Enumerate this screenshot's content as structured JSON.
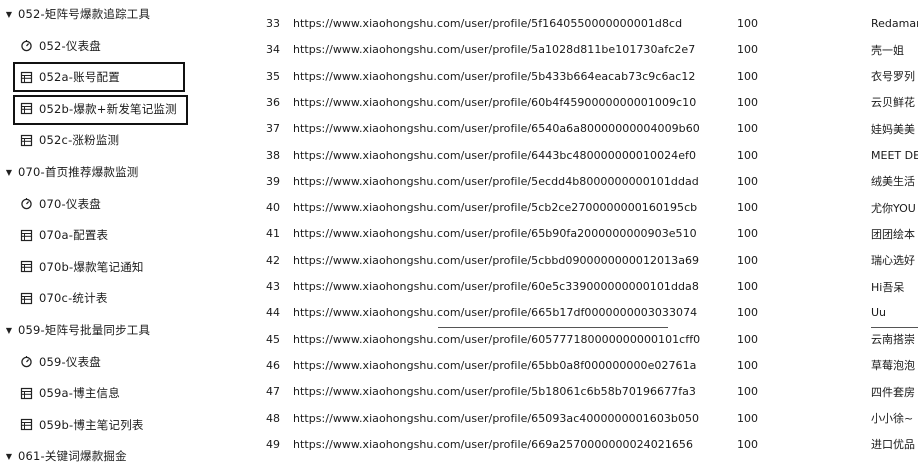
{
  "sidebar": {
    "items": [
      {
        "kind": "group",
        "icon": "caret-down",
        "label": "052-矩阵号爆款追踪工具"
      },
      {
        "kind": "child",
        "icon": "dashboard-icon",
        "label": "052-仪表盘"
      },
      {
        "kind": "child",
        "icon": "table-icon",
        "label": "052a-账号配置"
      },
      {
        "kind": "child",
        "icon": "table-icon",
        "label": "052b-爆款+新发笔记监测"
      },
      {
        "kind": "child",
        "icon": "table-icon",
        "label": "052c-涨粉监测"
      },
      {
        "kind": "group",
        "icon": "caret-down",
        "label": "070-首页推荐爆款监测"
      },
      {
        "kind": "child",
        "icon": "dashboard-icon",
        "label": "070-仪表盘"
      },
      {
        "kind": "child",
        "icon": "table-icon",
        "label": "070a-配置表"
      },
      {
        "kind": "child",
        "icon": "table-icon",
        "label": "070b-爆款笔记通知"
      },
      {
        "kind": "child",
        "icon": "table-icon",
        "label": "070c-统计表"
      },
      {
        "kind": "group",
        "icon": "caret-down",
        "label": "059-矩阵号批量同步工具"
      },
      {
        "kind": "child",
        "icon": "dashboard-icon",
        "label": "059-仪表盘"
      },
      {
        "kind": "child",
        "icon": "table-icon",
        "label": "059a-博主信息"
      },
      {
        "kind": "child",
        "icon": "table-icon",
        "label": "059b-博主笔记列表"
      },
      {
        "kind": "group",
        "icon": "caret-down",
        "label": "061-关键词爆款掘金"
      }
    ]
  },
  "table": {
    "rows": [
      {
        "num": "33",
        "url": "https://www.xiaohongshu.com/user/profile/5f1640550000000001d8cd",
        "value": "100",
        "name": "Redamar"
      },
      {
        "num": "34",
        "url": "https://www.xiaohongshu.com/user/profile/5a1028d811be101730afc2e7",
        "value": "100",
        "name": "壳一姐"
      },
      {
        "num": "35",
        "url": "https://www.xiaohongshu.com/user/profile/5b433b664eacab73c9c6ac12",
        "value": "100",
        "name": "衣号罗列"
      },
      {
        "num": "36",
        "url": "https://www.xiaohongshu.com/user/profile/60b4f4590000000001009c10",
        "value": "100",
        "name": "云贝鲜花"
      },
      {
        "num": "37",
        "url": "https://www.xiaohongshu.com/user/profile/6540a6a80000000004009b60",
        "value": "100",
        "name": "娃妈美美"
      },
      {
        "num": "38",
        "url": "https://www.xiaohongshu.com/user/profile/6443bc480000000010024ef0",
        "value": "100",
        "name": "MEET DE"
      },
      {
        "num": "39",
        "url": "https://www.xiaohongshu.com/user/profile/5ecdd4b8000000000101ddad",
        "value": "100",
        "name": "绒美生活"
      },
      {
        "num": "40",
        "url": "https://www.xiaohongshu.com/user/profile/5cb2ce2700000000160195cb",
        "value": "100",
        "name": "尤你YOU"
      },
      {
        "num": "41",
        "url": "https://www.xiaohongshu.com/user/profile/65b90fa2000000000903e510",
        "value": "100",
        "name": "团团绘本"
      },
      {
        "num": "42",
        "url": "https://www.xiaohongshu.com/user/profile/5cbbd0900000000012013a69",
        "value": "100",
        "name": "瑞心选好"
      },
      {
        "num": "43",
        "url": "https://www.xiaohongshu.com/user/profile/60e5c339000000000101dda8",
        "value": "100",
        "name": "Hi吾呆"
      },
      {
        "num": "44",
        "url": "https://www.xiaohongshu.com/user/profile/665b17df0000000003033074",
        "value": "100",
        "name": "Uu"
      },
      {
        "num": "45",
        "url": "https://www.xiaohongshu.com/user/profile/605777180000000000101cff0",
        "value": "100",
        "name": "云南搭崇"
      },
      {
        "num": "46",
        "url": "https://www.xiaohongshu.com/user/profile/65bb0a8f000000000e02761a",
        "value": "100",
        "name": "草莓泡泡"
      },
      {
        "num": "47",
        "url": "https://www.xiaohongshu.com/user/profile/5b18061c6b58b70196677fa3",
        "value": "100",
        "name": "四件套房"
      },
      {
        "num": "48",
        "url": "https://www.xiaohongshu.com/user/profile/65093ac4000000001603b050",
        "value": "100",
        "name": "小小徐~"
      },
      {
        "num": "49",
        "url": "https://www.xiaohongshu.com/user/profile/669a2570000000024021656",
        "value": "100",
        "name": "进口优品"
      }
    ]
  }
}
